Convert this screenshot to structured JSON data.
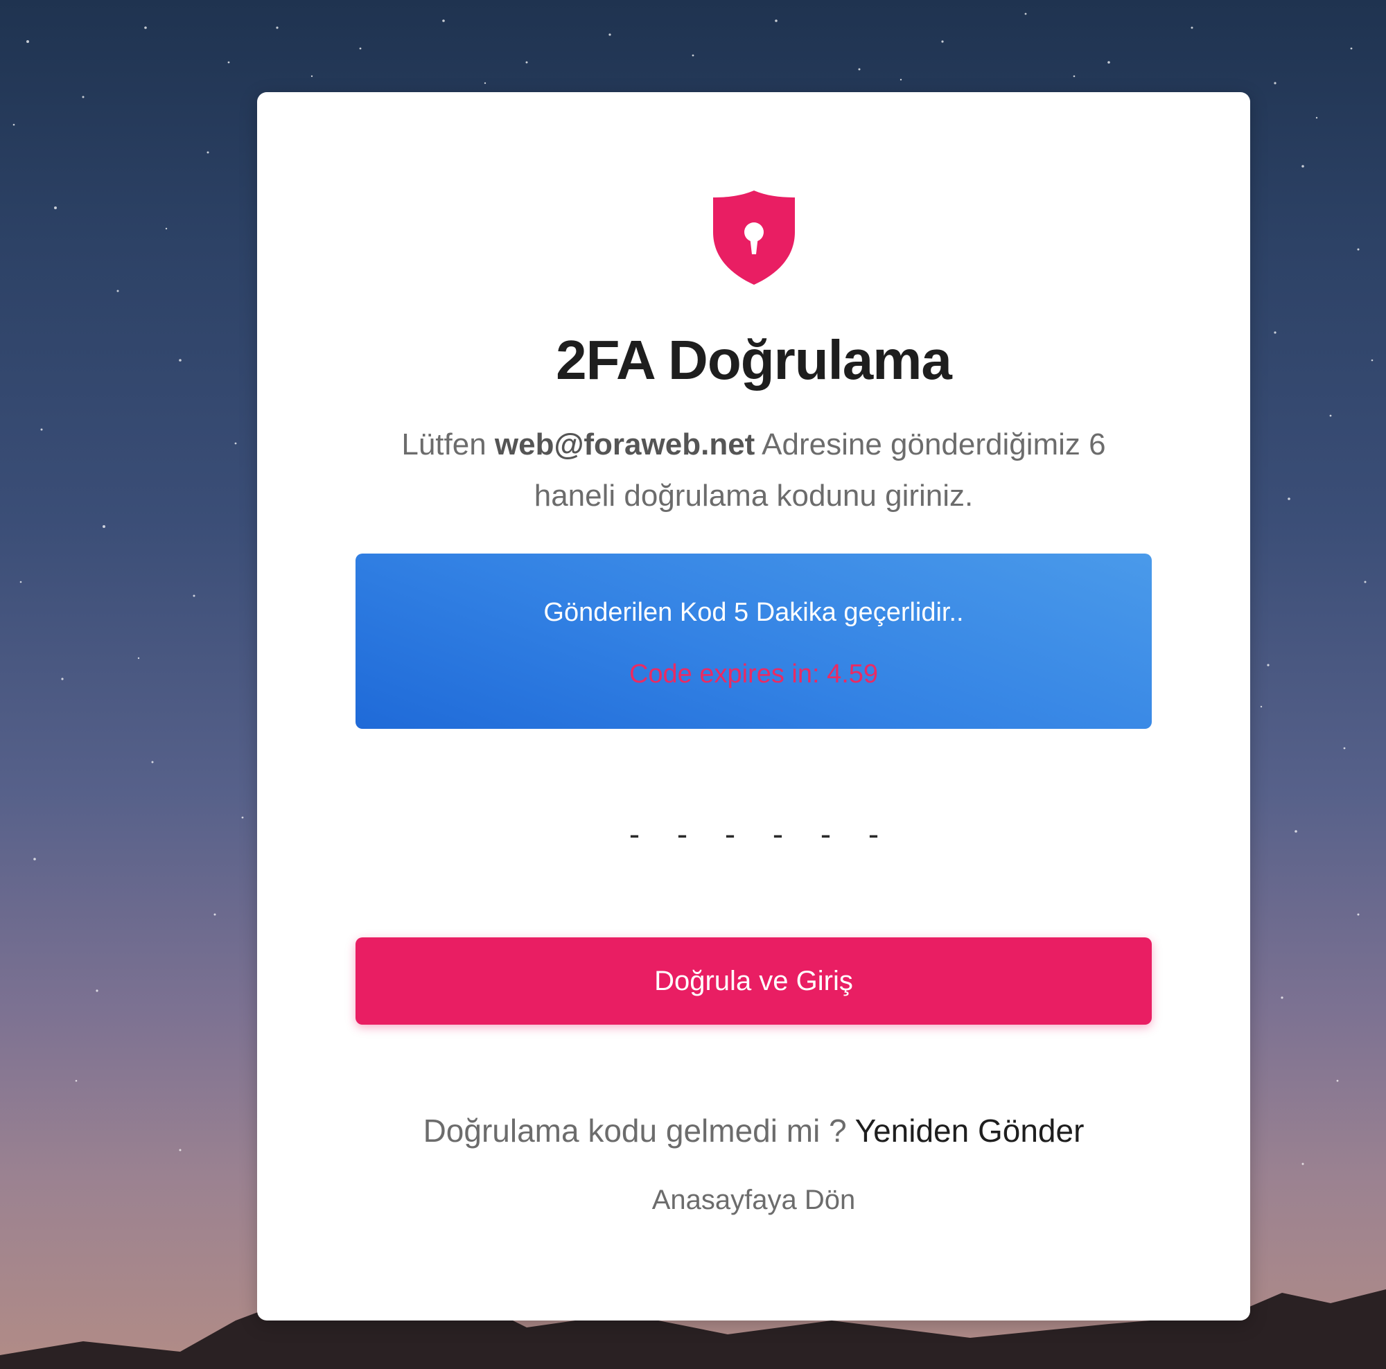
{
  "colors": {
    "accent": "#e91e63",
    "info_box": "#3382e4",
    "expires_text": "#ea2b63",
    "title": "#1e1e1e",
    "muted_text": "#6c6c6c",
    "card_background": "#ffffff"
  },
  "header": {
    "icon": "shield-keyhole-icon",
    "title": "2FA Doğrulama"
  },
  "instructions": {
    "prefix": "Lütfen ",
    "email": "web@foraweb.net",
    "suffix": " Adresine gönderdiğimiz 6 haneli doğrulama kodunu giriniz."
  },
  "info_box": {
    "validity_message": "Gönderilen Kod 5 Dakika geçerlidir..",
    "expires_text": "Code expires in: 4.59"
  },
  "code_input": {
    "placeholder": "- - - - - -",
    "value": ""
  },
  "actions": {
    "submit_label": "Doğrula ve Giriş",
    "resend_prompt": "Doğrulama kodu gelmedi mi ? ",
    "resend_link": "Yeniden Gönder",
    "home_link": "Anasayfaya Dön"
  }
}
